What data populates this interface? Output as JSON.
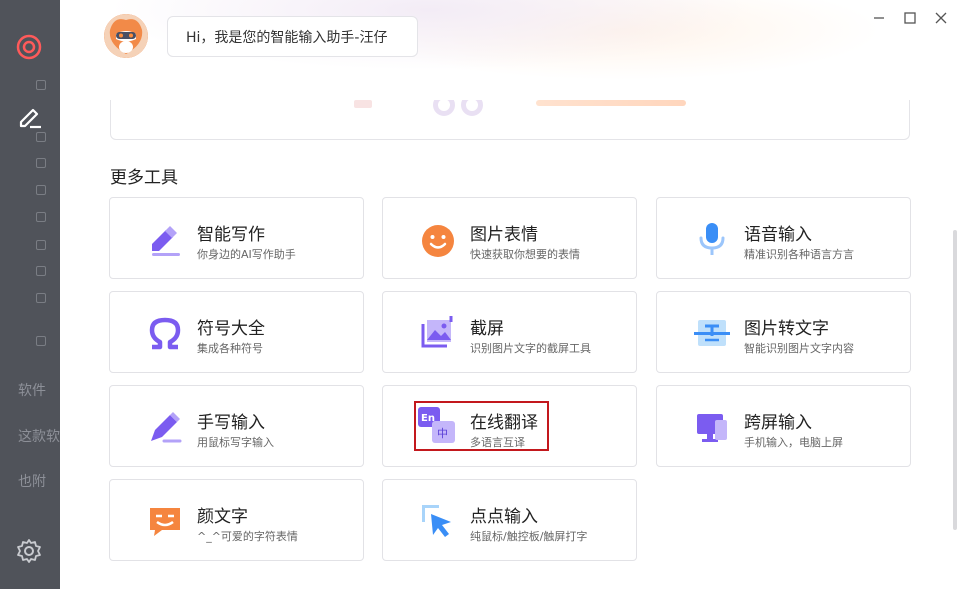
{
  "window": {
    "controls": {
      "minimize": "—",
      "maximize": "☐",
      "close": "✕"
    }
  },
  "header": {
    "greeting": "Hi，我是您的智能输入助手-汪仔"
  },
  "section": {
    "title": "更多工具"
  },
  "tools": [
    {
      "title": "智能写作",
      "desc": "你身边的AI写作助手",
      "icon": "pen-writing-icon"
    },
    {
      "title": "图片表情",
      "desc": "快速获取你想要的表情",
      "icon": "smiley-face-icon"
    },
    {
      "title": "语音输入",
      "desc": "精准识别各种语言方言",
      "icon": "microphone-icon"
    },
    {
      "title": "符号大全",
      "desc": "集成各种符号",
      "icon": "omega-symbol-icon"
    },
    {
      "title": "截屏",
      "desc": "识别图片文字的截屏工具",
      "icon": "screenshot-crop-icon"
    },
    {
      "title": "图片转文字",
      "desc": "智能识别图片文字内容",
      "icon": "image-to-text-icon"
    },
    {
      "title": "手写输入",
      "desc": "用鼠标写字输入",
      "icon": "handwriting-pen-icon"
    },
    {
      "title": "在线翻译",
      "desc": "多语言互译",
      "icon": "translate-en-zh-icon"
    },
    {
      "title": "跨屏输入",
      "desc": "手机输入，电脑上屏",
      "icon": "cross-screen-icon"
    },
    {
      "title": "颜文字",
      "desc": "^_^可爱的字符表情",
      "icon": "kaomoji-icon"
    },
    {
      "title": "点点输入",
      "desc": "纯鼠标/触控板/触屏打字",
      "icon": "pointer-click-icon"
    }
  ],
  "background_app": {
    "sidebar_texts": [
      "软件",
      "这款软",
      "也附"
    ]
  },
  "colors": {
    "accent_purple": "#7b5cf0",
    "accent_orange": "#f5853f",
    "accent_blue": "#3a8ef6",
    "highlight_red": "#c3181d"
  }
}
